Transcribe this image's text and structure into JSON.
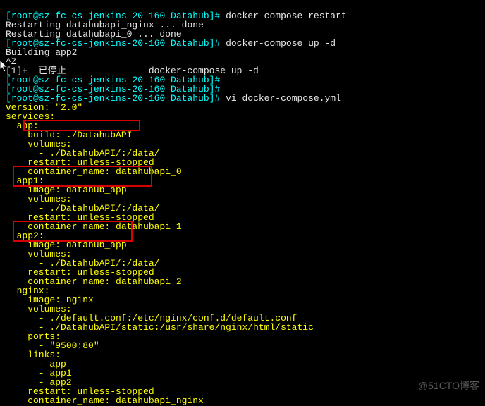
{
  "prompt": {
    "host_open": "[",
    "user_host": "root@sz-fc-cs-jenkins-20-160 Datahub",
    "host_close": "]# "
  },
  "cmd": {
    "restart": "docker-compose restart",
    "up": "docker-compose up -d",
    "vi": "vi docker-compose.yml"
  },
  "out": {
    "r1": "Restarting datahubapi_nginx ... done",
    "r2": "Restarting datahubapi_0 ... done",
    "build": "Building app2",
    "ctrlz": "^Z",
    "stopped": "[1]+  已停止               docker-compose up -d"
  },
  "yaml": {
    "version": "version: \"2.0\"",
    "services": "services:",
    "app": "  app:",
    "app_build": "    build: ./DatahubAPI",
    "app_vol": "    volumes:",
    "app_vol1": "      - ./DatahubAPI/:/data/",
    "app_restart": "    restart: unless-stopped",
    "app_cname": "    container_name: datahubapi_0",
    "app1": "  app1:",
    "app1_img": "    image: datahub_app",
    "app1_vol": "    volumes:",
    "app1_vol1": "      - ./DatahubAPI/:/data/",
    "app1_restart": "    restart: unless-stopped",
    "app1_cname": "    container_name: datahubapi_1",
    "app2": "  app2:",
    "app2_img": "    image: datahub_app",
    "app2_vol": "    volumes:",
    "app2_vol1": "      - ./DatahubAPI/:/data/",
    "app2_restart": "    restart: unless-stopped",
    "app2_cname": "    container_name: datahubapi_2",
    "nginx": "  nginx:",
    "nginx_img": "    image: nginx",
    "nginx_vol": "    volumes:",
    "nginx_vol1": "      - ./default.conf:/etc/nginx/conf.d/default.conf",
    "nginx_vol2": "      - ./DatahubAPI/static:/usr/share/nginx/html/static",
    "nginx_ports": "    ports:",
    "nginx_ports1": "      - \"9500:80\"",
    "nginx_links": "    links:",
    "nginx_links1": "      - app",
    "nginx_links2": "      - app1",
    "nginx_links3": "      - app2",
    "nginx_restart": "    restart: unless-stopped",
    "nginx_cname": "    container_name: datahubapi_nginx"
  },
  "watermark": "@51CTO博客"
}
